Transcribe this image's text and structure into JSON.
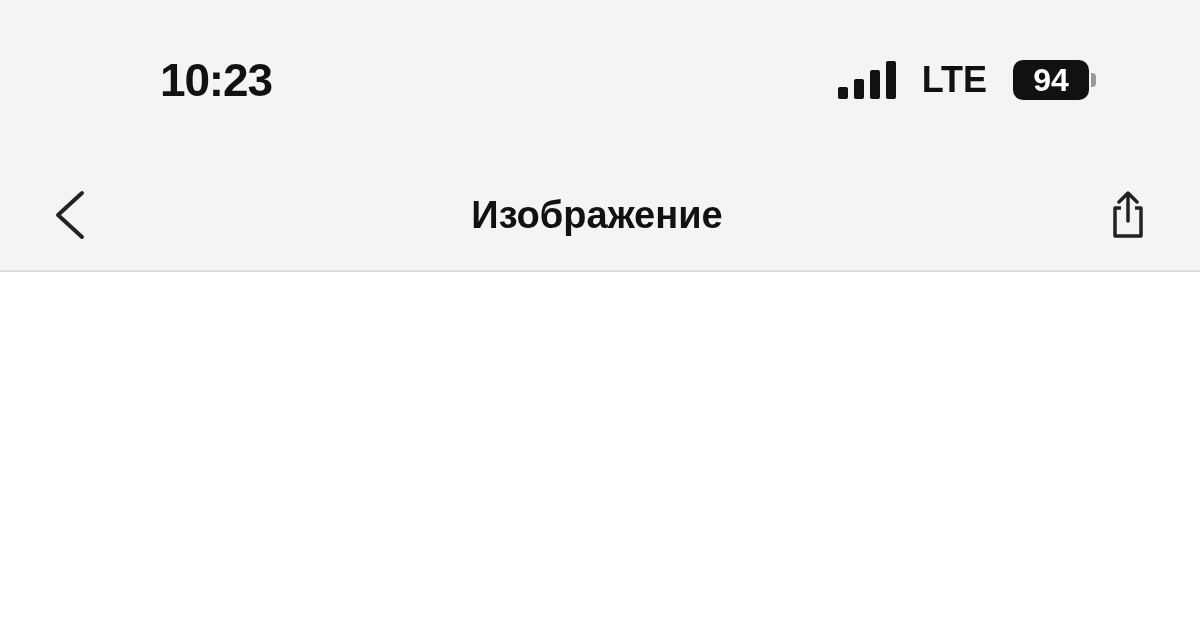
{
  "status_bar": {
    "time": "10:23",
    "network": "LTE",
    "battery": "94"
  },
  "nav_bar": {
    "title": "Изображение"
  }
}
